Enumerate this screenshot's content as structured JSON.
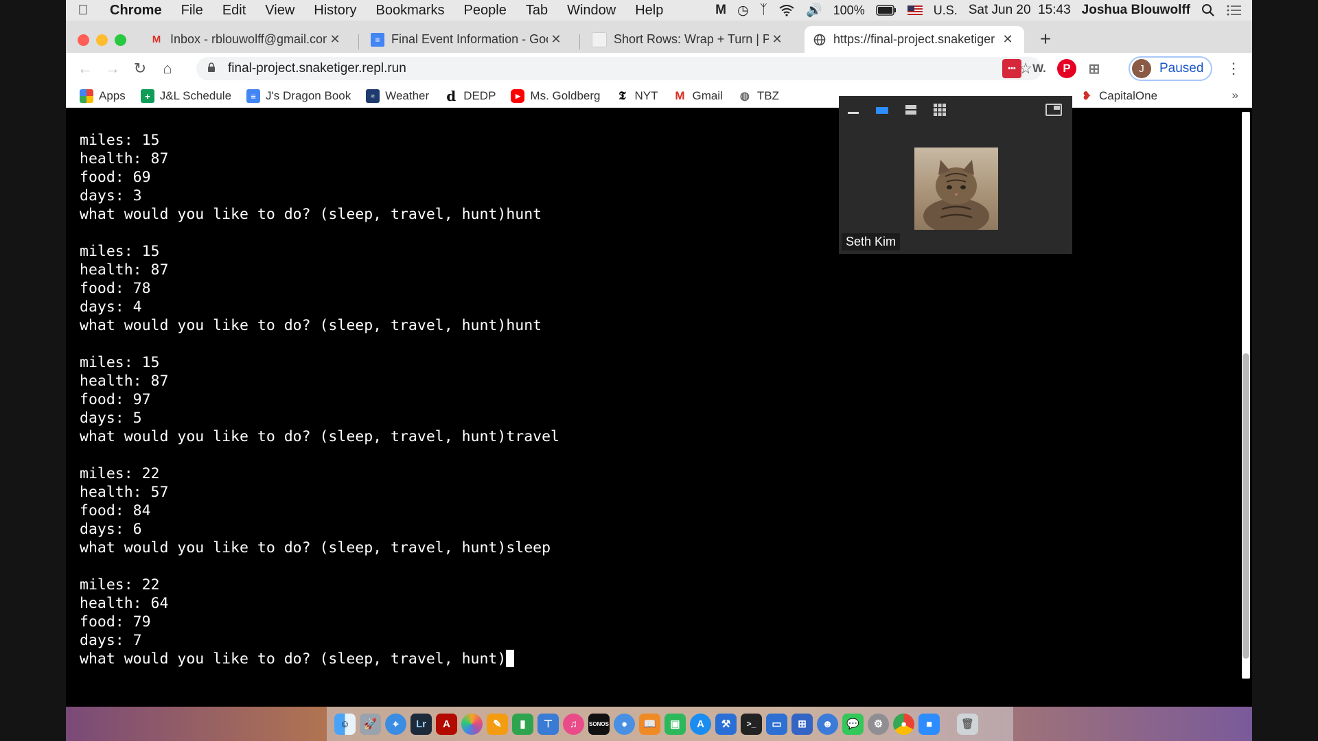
{
  "menubar": {
    "app": "Chrome",
    "items": [
      "File",
      "Edit",
      "View",
      "History",
      "Bookmarks",
      "People",
      "Tab",
      "Window",
      "Help"
    ],
    "battery": "100%",
    "input_source": "U.S.",
    "datetime": "Sat Jun 20  15:43",
    "user": "Joshua Blouwolff"
  },
  "tabs": [
    {
      "title": "Inbox - rblouwolff@gmail.com",
      "icon": "gmail-icon"
    },
    {
      "title": "Final Event Information - Goog",
      "icon": "docs-icon"
    },
    {
      "title": "Short Rows: Wrap + Turn | Pur",
      "icon": "page-icon"
    },
    {
      "title": "https://final-project.snaketiger",
      "icon": "globe-icon"
    }
  ],
  "toolbar": {
    "url": "final-project.snaketiger.repl.run",
    "profile_initial": "J",
    "profile_status": "Paused"
  },
  "bookmarks": [
    "Apps",
    "J&L Schedule",
    "J's Dragon Book",
    "Weather",
    "DEDP",
    "Ms. Goldberg",
    "NYT",
    "Gmail",
    "TBZ"
  ],
  "bookmark_capitalone": "CapitalOne",
  "bookmark_more": "»",
  "terminal": {
    "lines": [
      "miles: 15",
      "health: 87",
      "food: 69",
      "days: 3",
      "what would you like to do? (sleep, travel, hunt)hunt",
      "",
      "miles: 15",
      "health: 87",
      "food: 78",
      "days: 4",
      "what would you like to do? (sleep, travel, hunt)hunt",
      "",
      "miles: 15",
      "health: 87",
      "food: 97",
      "days: 5",
      "what would you like to do? (sleep, travel, hunt)travel",
      "",
      "miles: 22",
      "health: 57",
      "food: 84",
      "days: 6",
      "what would you like to do? (sleep, travel, hunt)sleep",
      "",
      "miles: 22",
      "health: 64",
      "food: 79",
      "days: 7",
      "what would you like to do? (sleep, travel, hunt)"
    ]
  },
  "video": {
    "participant": "Seth Kim"
  },
  "colors": {
    "close": "#ff5f57",
    "minimize": "#febc2e",
    "maximize": "#28c840",
    "terminal_bg": "#000000",
    "terminal_fg": "#ffffff",
    "paused_text": "#1a56c8"
  }
}
